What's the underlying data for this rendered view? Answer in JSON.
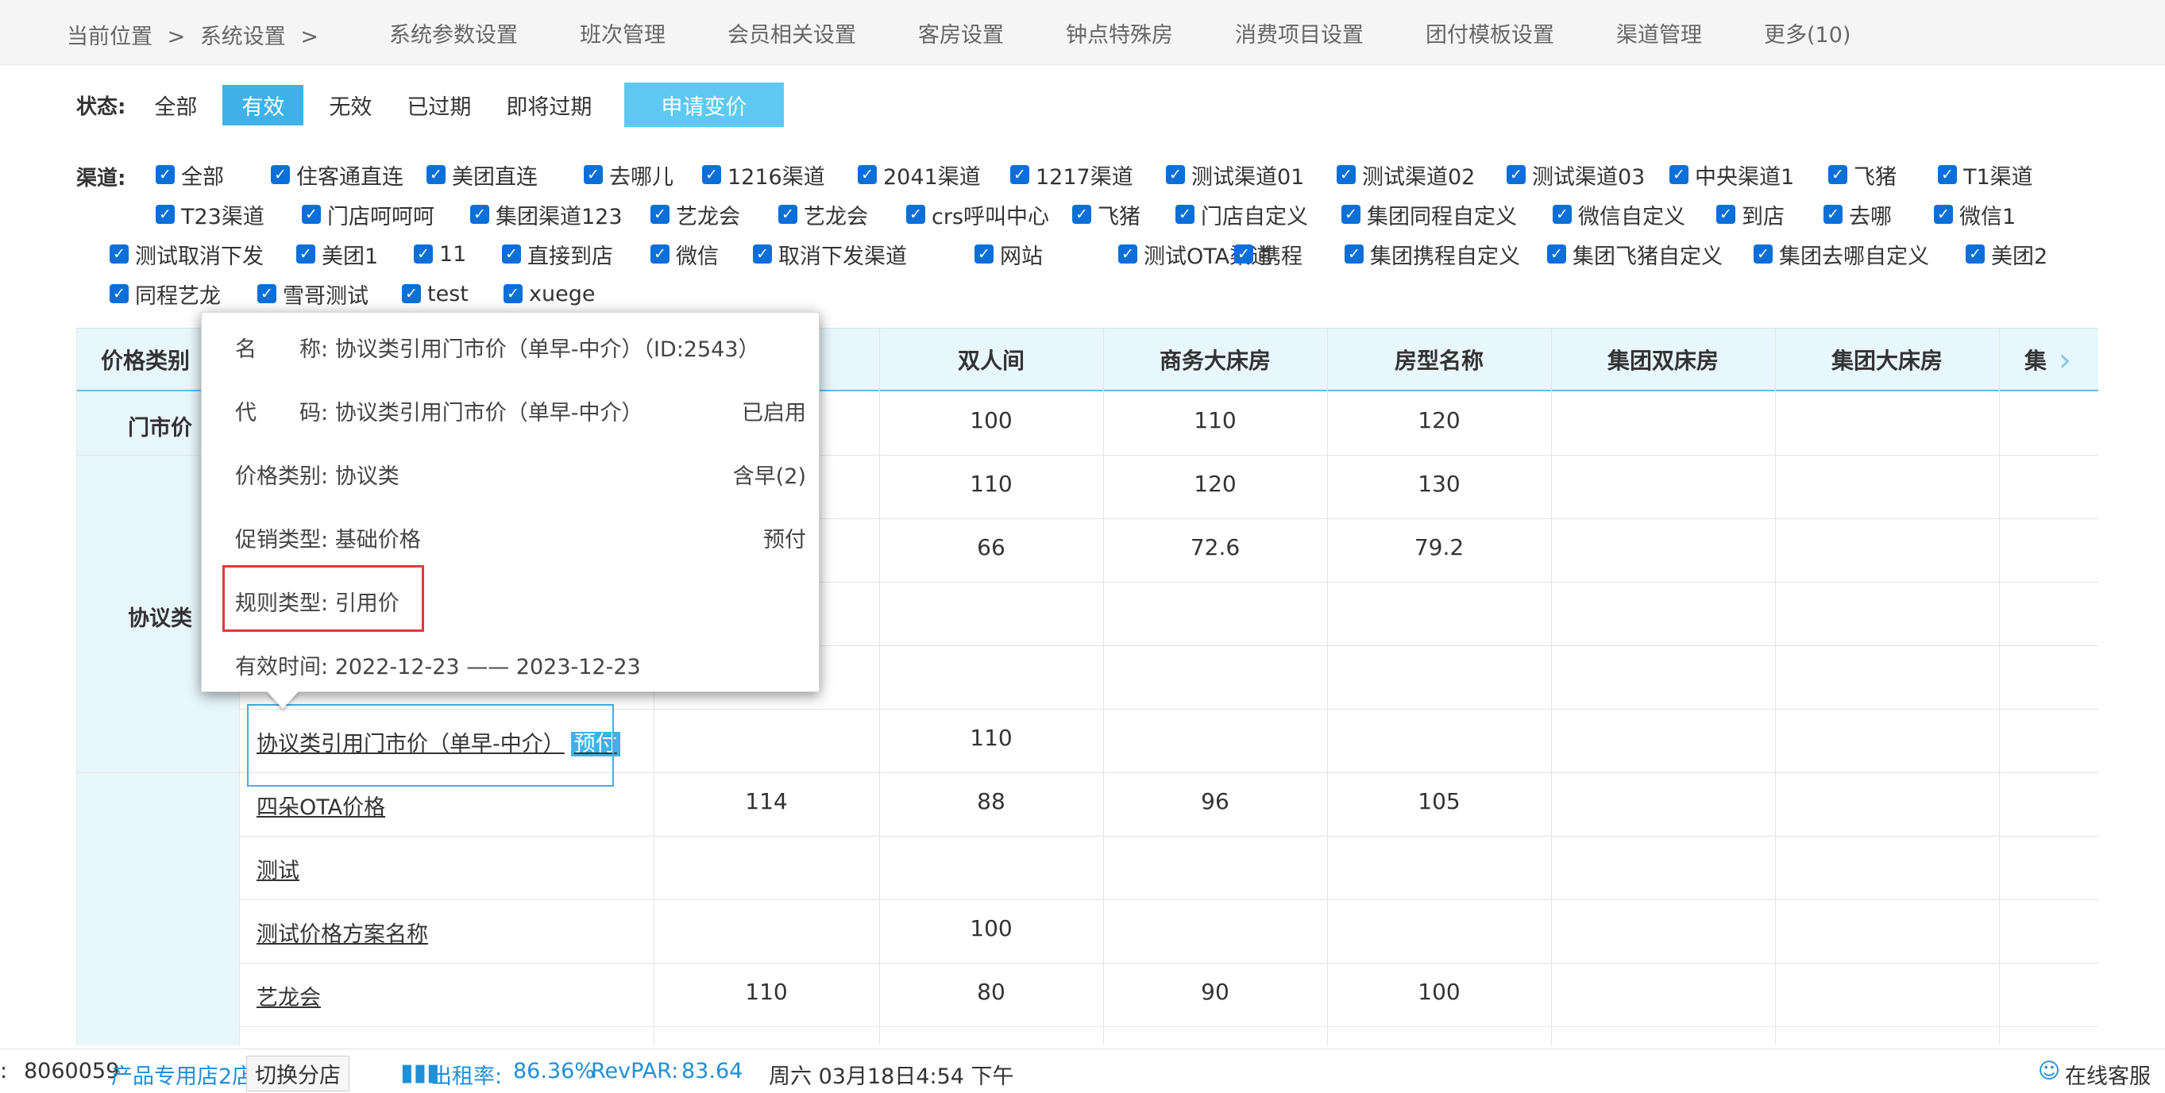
{
  "breadcrumb": {
    "location": "当前位置",
    "sep1": ">",
    "section": "系统设置",
    "sep2": ">"
  },
  "nav": [
    "系统参数设置",
    "班次管理",
    "会员相关设置",
    "客房设置",
    "钟点特殊房",
    "消费项目设置",
    "团付模板设置",
    "渠道管理",
    "更多(10)"
  ],
  "status_filter": {
    "label": "状态:",
    "options": [
      "全部",
      "有效",
      "无效",
      "已过期",
      "即将过期"
    ],
    "active": "有效",
    "apply_button": "申请变价"
  },
  "channels": {
    "label": "渠道:",
    "items": [
      "全部",
      "住客通直连",
      "美团直连",
      "去哪儿",
      "1216渠道",
      "2041渠道",
      "1217渠道",
      "测试渠道01",
      "测试渠道02",
      "测试渠道03",
      "中央渠道1",
      "飞猪",
      "T1渠道",
      "T23渠道",
      "门店呵呵呵",
      "集团渠道123",
      "艺龙会",
      "艺龙会",
      "crs呼叫中心",
      "飞猪",
      "门店自定义",
      "集团同程自定义",
      "微信自定义",
      "到店",
      "去哪",
      "微信1",
      "测试取消下发",
      "美团1",
      "11",
      "直接到店",
      "微信",
      "取消下发渠道",
      "网站",
      "测试OTA渠道",
      "携程",
      "集团携程自定义",
      "集团飞猪自定义",
      "集团去哪自定义",
      "美团2",
      "同程艺龙",
      "雪哥测试",
      "test",
      "xuege"
    ]
  },
  "table": {
    "headers": [
      "价格类别",
      "双人间",
      "商务大床房",
      "房型名称",
      "集团双床房",
      "集团大床房",
      "集"
    ],
    "categories": [
      "门市价",
      "协议类"
    ],
    "rows": [
      {
        "name": "",
        "values": [
          "",
          "100",
          "110",
          "120",
          "",
          ""
        ]
      },
      {
        "name": "",
        "values": [
          "",
          "110",
          "120",
          "130",
          "",
          ""
        ]
      },
      {
        "name": "",
        "values": [
          "",
          "66",
          "72.6",
          "79.2",
          "",
          ""
        ]
      },
      {
        "name": "",
        "values": [
          "",
          "",
          "",
          "",
          "",
          ""
        ]
      },
      {
        "name": "",
        "values": [
          "",
          "",
          "",
          "",
          "",
          ""
        ]
      },
      {
        "name": "协议类引用门市价（单早-中介）",
        "tag": "预付",
        "values": [
          "",
          "110",
          "",
          "",
          "",
          ""
        ]
      },
      {
        "name": "四朵OTA价格",
        "values": [
          "114",
          "88",
          "96",
          "105",
          "",
          ""
        ]
      },
      {
        "name": "测试",
        "values": [
          "",
          "",
          "",
          "",
          "",
          ""
        ]
      },
      {
        "name": "测试价格方案名称",
        "values": [
          "",
          "100",
          "",
          "",
          "",
          ""
        ]
      },
      {
        "name": "艺龙会",
        "values": [
          "110",
          "80",
          "90",
          "100",
          "",
          ""
        ]
      }
    ]
  },
  "popover": {
    "name_label": "名　　称:",
    "name_value": "协议类引用门市价（单早-中介）（ID:2543）",
    "code_label": "代　　码:",
    "code_value": "协议类引用门市价（单早-中介）",
    "code_status": "已启用",
    "cat_label": "价格类别:",
    "cat_value": "协议类",
    "cat_right": "含早(2)",
    "promo_label": "促销类型:",
    "promo_value": "基础价格",
    "promo_right": "预付",
    "rule_label": "规则类型:",
    "rule_value": "引用价",
    "valid_label": "有效时间:",
    "valid_value": "2022-12-23 —— 2023-12-23"
  },
  "statusbar": {
    "store_prefix": ":",
    "store_id": "8060059",
    "store_name": "产品专用店2店",
    "switch": "切换分店",
    "occupancy": "出租率:",
    "occupancy_val": "86.36%",
    "revpar": "RevPAR:",
    "revpar_val": "83.64",
    "datetime": "周六 03月18日4:54 下午",
    "service": "在线客服"
  },
  "colors": {
    "accent": "#3eb2e8",
    "checkbox": "#0a6fd8",
    "highlight": "#e53935"
  }
}
